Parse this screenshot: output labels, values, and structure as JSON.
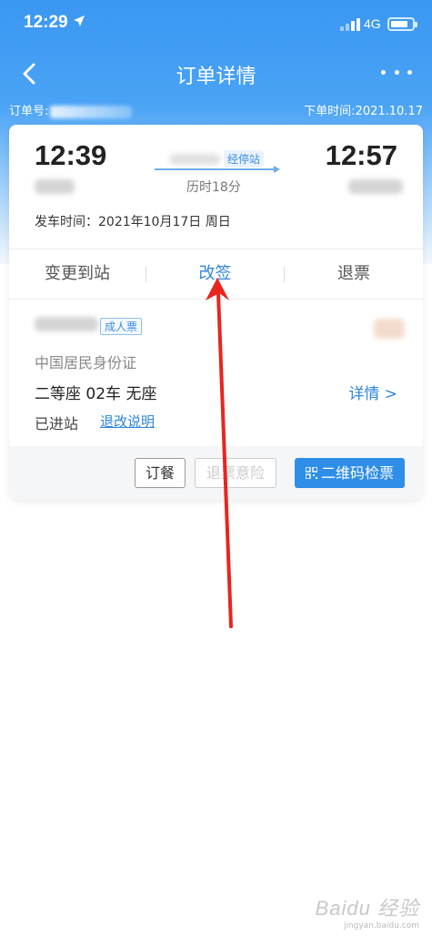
{
  "status_bar": {
    "time": "12:29",
    "network": "4G"
  },
  "nav": {
    "title": "订单详情"
  },
  "order": {
    "number_label": "订单号:",
    "order_time": "下单时间:2021.10.17"
  },
  "trip": {
    "departure_time": "12:39",
    "arrival_time": "12:57",
    "stops_label": "经停站",
    "duration": "历时18分",
    "depart_date": "发车时间：2021年10月17日 周日"
  },
  "actions": [
    {
      "label": "变更到站"
    },
    {
      "label": "改签"
    },
    {
      "label": "退票"
    }
  ],
  "passenger": {
    "ticket_type": "成人票",
    "id_type": "中国居民身份证",
    "seat": "二等座 02车 无座",
    "detail_link": "详情 >",
    "status": "已进站",
    "refund_link": "退改说明"
  },
  "footer_buttons": {
    "meal": "订餐",
    "insurance": "退票意险",
    "qr_ticket": "二维码检票"
  },
  "watermark": {
    "main": "Baidu 经验",
    "sub": "jingyan.baidu.com"
  },
  "colors": {
    "primary": "#2f86d9",
    "header": "#3a97f2",
    "annotation_arrow": "#e8251f"
  }
}
